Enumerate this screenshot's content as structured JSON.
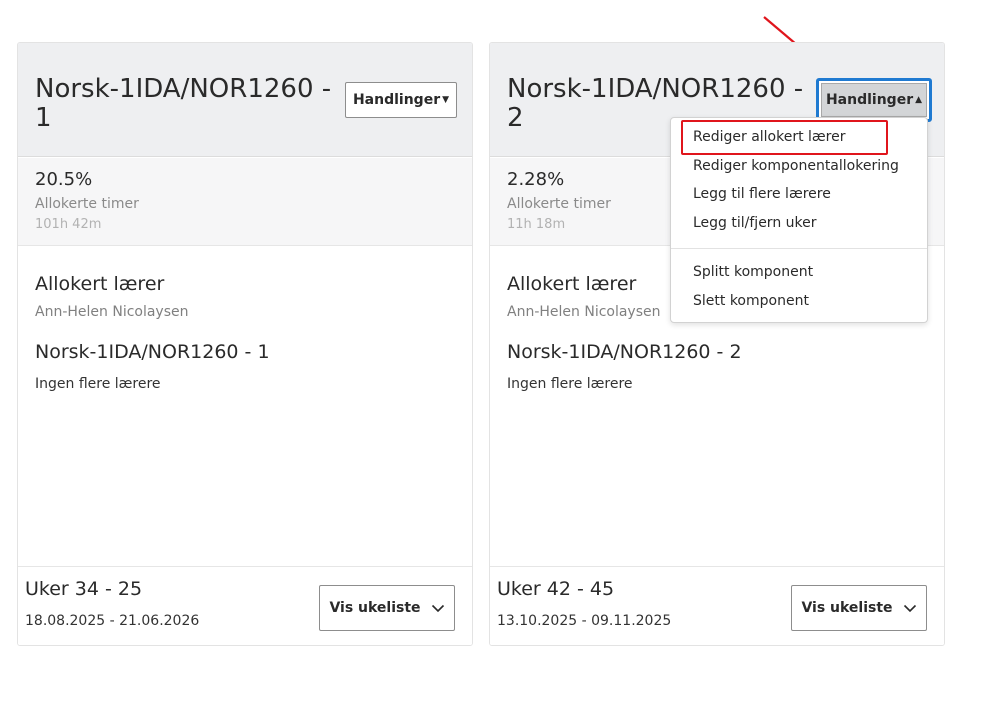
{
  "actions_label": "Handlinger",
  "cards": [
    {
      "title": "Norsk-1IDA/NOR1260 - 1",
      "percent": "20.5%",
      "percent_label": "Allokerte timer",
      "hours": "101h 42m",
      "allocated_heading": "Allokert lærer",
      "teacher": "Ann-Helen Nicolaysen",
      "component_title": "Norsk-1IDA/NOR1260 - 1",
      "more_teachers": "Ingen flere lærere",
      "weeks": "Uker 34 - 25",
      "dates": "18.08.2025 - 21.06.2026",
      "week_button": "Vis ukeliste"
    },
    {
      "title": "Norsk-1IDA/NOR1260 - 2",
      "percent": "2.28%",
      "percent_label": "Allokerte timer",
      "hours": "11h 18m",
      "allocated_heading": "Allokert lærer",
      "teacher": "Ann-Helen Nicolaysen",
      "component_title": "Norsk-1IDA/NOR1260 - 2",
      "more_teachers": "Ingen flere lærere",
      "weeks": "Uker 42 - 45",
      "dates": "13.10.2025 - 09.11.2025",
      "week_button": "Vis ukeliste"
    }
  ],
  "menu": {
    "items": [
      "Rediger allokert lærer",
      "Rediger komponentallokering",
      "Legg til flere lærere",
      "Legg til/fjern uker",
      "Splitt komponent",
      "Slett komponent"
    ]
  },
  "colors": {
    "focus_ring": "#1f7ad1",
    "annotation_red": "#e0151c",
    "header_bg": "#eeeff1"
  }
}
